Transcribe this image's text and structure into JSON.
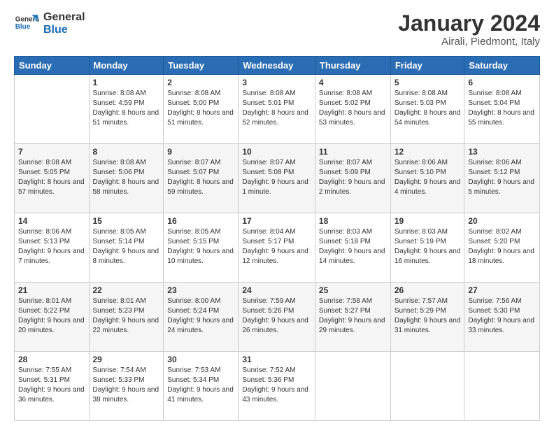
{
  "header": {
    "logo_general": "General",
    "logo_blue": "Blue",
    "month_title": "January 2024",
    "subtitle": "Airali, Piedmont, Italy"
  },
  "days_of_week": [
    "Sunday",
    "Monday",
    "Tuesday",
    "Wednesday",
    "Thursday",
    "Friday",
    "Saturday"
  ],
  "weeks": [
    [
      {
        "day": "",
        "sunrise": "",
        "sunset": "",
        "daylight": ""
      },
      {
        "day": "1",
        "sunrise": "Sunrise: 8:08 AM",
        "sunset": "Sunset: 4:59 PM",
        "daylight": "Daylight: 8 hours and 51 minutes."
      },
      {
        "day": "2",
        "sunrise": "Sunrise: 8:08 AM",
        "sunset": "Sunset: 5:00 PM",
        "daylight": "Daylight: 8 hours and 51 minutes."
      },
      {
        "day": "3",
        "sunrise": "Sunrise: 8:08 AM",
        "sunset": "Sunset: 5:01 PM",
        "daylight": "Daylight: 8 hours and 52 minutes."
      },
      {
        "day": "4",
        "sunrise": "Sunrise: 8:08 AM",
        "sunset": "Sunset: 5:02 PM",
        "daylight": "Daylight: 8 hours and 53 minutes."
      },
      {
        "day": "5",
        "sunrise": "Sunrise: 8:08 AM",
        "sunset": "Sunset: 5:03 PM",
        "daylight": "Daylight: 8 hours and 54 minutes."
      },
      {
        "day": "6",
        "sunrise": "Sunrise: 8:08 AM",
        "sunset": "Sunset: 5:04 PM",
        "daylight": "Daylight: 8 hours and 55 minutes."
      }
    ],
    [
      {
        "day": "7",
        "sunrise": "Sunrise: 8:08 AM",
        "sunset": "Sunset: 5:05 PM",
        "daylight": "Daylight: 8 hours and 57 minutes."
      },
      {
        "day": "8",
        "sunrise": "Sunrise: 8:08 AM",
        "sunset": "Sunset: 5:06 PM",
        "daylight": "Daylight: 8 hours and 58 minutes."
      },
      {
        "day": "9",
        "sunrise": "Sunrise: 8:07 AM",
        "sunset": "Sunset: 5:07 PM",
        "daylight": "Daylight: 8 hours and 59 minutes."
      },
      {
        "day": "10",
        "sunrise": "Sunrise: 8:07 AM",
        "sunset": "Sunset: 5:08 PM",
        "daylight": "Daylight: 9 hours and 1 minute."
      },
      {
        "day": "11",
        "sunrise": "Sunrise: 8:07 AM",
        "sunset": "Sunset: 5:09 PM",
        "daylight": "Daylight: 9 hours and 2 minutes."
      },
      {
        "day": "12",
        "sunrise": "Sunrise: 8:06 AM",
        "sunset": "Sunset: 5:10 PM",
        "daylight": "Daylight: 9 hours and 4 minutes."
      },
      {
        "day": "13",
        "sunrise": "Sunrise: 8:06 AM",
        "sunset": "Sunset: 5:12 PM",
        "daylight": "Daylight: 9 hours and 5 minutes."
      }
    ],
    [
      {
        "day": "14",
        "sunrise": "Sunrise: 8:06 AM",
        "sunset": "Sunset: 5:13 PM",
        "daylight": "Daylight: 9 hours and 7 minutes."
      },
      {
        "day": "15",
        "sunrise": "Sunrise: 8:05 AM",
        "sunset": "Sunset: 5:14 PM",
        "daylight": "Daylight: 9 hours and 8 minutes."
      },
      {
        "day": "16",
        "sunrise": "Sunrise: 8:05 AM",
        "sunset": "Sunset: 5:15 PM",
        "daylight": "Daylight: 9 hours and 10 minutes."
      },
      {
        "day": "17",
        "sunrise": "Sunrise: 8:04 AM",
        "sunset": "Sunset: 5:17 PM",
        "daylight": "Daylight: 9 hours and 12 minutes."
      },
      {
        "day": "18",
        "sunrise": "Sunrise: 8:03 AM",
        "sunset": "Sunset: 5:18 PM",
        "daylight": "Daylight: 9 hours and 14 minutes."
      },
      {
        "day": "19",
        "sunrise": "Sunrise: 8:03 AM",
        "sunset": "Sunset: 5:19 PM",
        "daylight": "Daylight: 9 hours and 16 minutes."
      },
      {
        "day": "20",
        "sunrise": "Sunrise: 8:02 AM",
        "sunset": "Sunset: 5:20 PM",
        "daylight": "Daylight: 9 hours and 18 minutes."
      }
    ],
    [
      {
        "day": "21",
        "sunrise": "Sunrise: 8:01 AM",
        "sunset": "Sunset: 5:22 PM",
        "daylight": "Daylight: 9 hours and 20 minutes."
      },
      {
        "day": "22",
        "sunrise": "Sunrise: 8:01 AM",
        "sunset": "Sunset: 5:23 PM",
        "daylight": "Daylight: 9 hours and 22 minutes."
      },
      {
        "day": "23",
        "sunrise": "Sunrise: 8:00 AM",
        "sunset": "Sunset: 5:24 PM",
        "daylight": "Daylight: 9 hours and 24 minutes."
      },
      {
        "day": "24",
        "sunrise": "Sunrise: 7:59 AM",
        "sunset": "Sunset: 5:26 PM",
        "daylight": "Daylight: 9 hours and 26 minutes."
      },
      {
        "day": "25",
        "sunrise": "Sunrise: 7:58 AM",
        "sunset": "Sunset: 5:27 PM",
        "daylight": "Daylight: 9 hours and 29 minutes."
      },
      {
        "day": "26",
        "sunrise": "Sunrise: 7:57 AM",
        "sunset": "Sunset: 5:29 PM",
        "daylight": "Daylight: 9 hours and 31 minutes."
      },
      {
        "day": "27",
        "sunrise": "Sunrise: 7:56 AM",
        "sunset": "Sunset: 5:30 PM",
        "daylight": "Daylight: 9 hours and 33 minutes."
      }
    ],
    [
      {
        "day": "28",
        "sunrise": "Sunrise: 7:55 AM",
        "sunset": "Sunset: 5:31 PM",
        "daylight": "Daylight: 9 hours and 36 minutes."
      },
      {
        "day": "29",
        "sunrise": "Sunrise: 7:54 AM",
        "sunset": "Sunset: 5:33 PM",
        "daylight": "Daylight: 9 hours and 38 minutes."
      },
      {
        "day": "30",
        "sunrise": "Sunrise: 7:53 AM",
        "sunset": "Sunset: 5:34 PM",
        "daylight": "Daylight: 9 hours and 41 minutes."
      },
      {
        "day": "31",
        "sunrise": "Sunrise: 7:52 AM",
        "sunset": "Sunset: 5:36 PM",
        "daylight": "Daylight: 9 hours and 43 minutes."
      },
      {
        "day": "",
        "sunrise": "",
        "sunset": "",
        "daylight": ""
      },
      {
        "day": "",
        "sunrise": "",
        "sunset": "",
        "daylight": ""
      },
      {
        "day": "",
        "sunrise": "",
        "sunset": "",
        "daylight": ""
      }
    ]
  ]
}
